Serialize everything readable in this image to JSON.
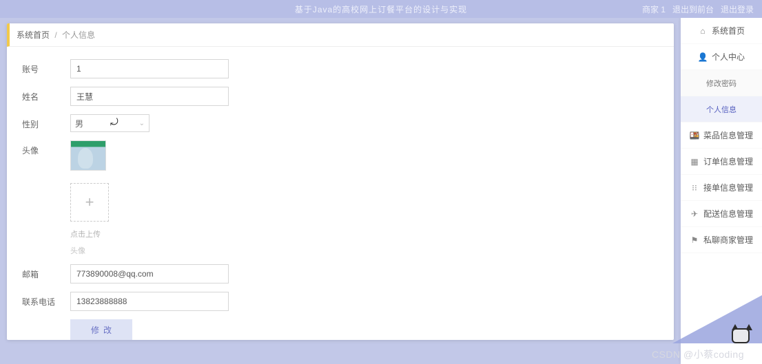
{
  "header": {
    "title": "基于Java的高校网上订餐平台的设计与实现",
    "right": [
      "商家 1",
      "退出到前台",
      "退出登录"
    ]
  },
  "breadcrumb": {
    "root": "系统首页",
    "current": "个人信息"
  },
  "form": {
    "account_label": "账号",
    "account_value": "1",
    "name_label": "姓名",
    "name_value": "王慧",
    "gender_label": "性别",
    "gender_value": "男",
    "avatar_label": "头像",
    "upload_hint": "点击上传",
    "avatar_caption": "头像",
    "email_label": "邮箱",
    "email_value": "773890008@qq.com",
    "phone_label": "联系电话",
    "phone_value": "13823888888",
    "submit_label": "修改"
  },
  "sidebar": {
    "items": [
      {
        "icon": "home",
        "label": "系统首页"
      },
      {
        "icon": "user",
        "label": "个人中心"
      },
      {
        "icon": "",
        "label": "修改密码",
        "sub": true
      },
      {
        "icon": "",
        "label": "个人信息",
        "sub": true,
        "active": true
      },
      {
        "icon": "goods",
        "label": "菜品信息管理"
      },
      {
        "icon": "grid",
        "label": "订单信息管理"
      },
      {
        "icon": "dots",
        "label": "接单信息管理"
      },
      {
        "icon": "send",
        "label": "配送信息管理"
      },
      {
        "icon": "flag",
        "label": "私聊商家管理"
      }
    ]
  },
  "watermark": "CSDN @小蔡coding"
}
